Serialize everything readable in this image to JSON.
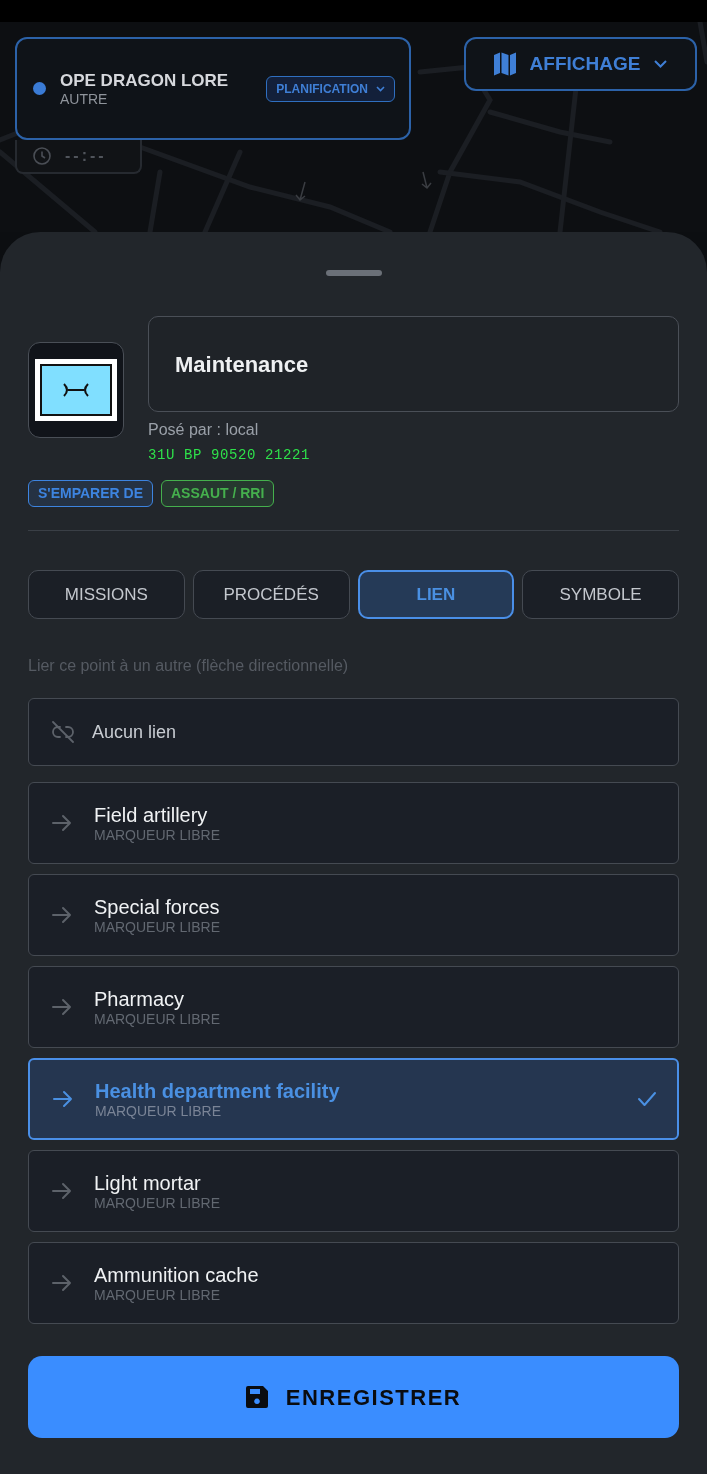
{
  "mission": {
    "title": "OPE DRAGON LORE",
    "subtitle": "AUTRE",
    "phase": "PLANIFICATION"
  },
  "clock": {
    "time": "--:--"
  },
  "display_menu": {
    "label": "AFFICHAGE"
  },
  "marker": {
    "name": "Maintenance",
    "placed_by": "Posé par : local",
    "grid_reference": "31U BP 90520 21221",
    "tags": [
      {
        "label": "S'EMPARER DE",
        "color": "#3d84e0"
      },
      {
        "label": "ASSAUT / RRI",
        "color": "#45b04d"
      }
    ]
  },
  "tabs": [
    {
      "label": "MISSIONS",
      "selected": false
    },
    {
      "label": "PROCÉDÉS",
      "selected": false
    },
    {
      "label": "LIEN",
      "selected": true
    },
    {
      "label": "SYMBOLE",
      "selected": false
    }
  ],
  "link_hint": "Lier ce point à un autre (flèche directionnelle)",
  "links": [
    {
      "kind": "none",
      "label": "Aucun lien",
      "selected": false
    },
    {
      "kind": "marker",
      "label": "Field artillery",
      "type": "MARQUEUR LIBRE",
      "selected": false
    },
    {
      "kind": "marker",
      "label": "Special forces",
      "type": "MARQUEUR LIBRE",
      "selected": false
    },
    {
      "kind": "marker",
      "label": "Pharmacy",
      "type": "MARQUEUR LIBRE",
      "selected": false
    },
    {
      "kind": "marker",
      "label": "Health department facility",
      "type": "MARQUEUR LIBRE",
      "selected": true
    },
    {
      "kind": "marker",
      "label": "Light mortar",
      "type": "MARQUEUR LIBRE",
      "selected": false
    },
    {
      "kind": "marker",
      "label": "Ammunition cache",
      "type": "MARQUEUR LIBRE",
      "selected": false
    }
  ],
  "save_button": {
    "label": "ENREGISTRER"
  }
}
